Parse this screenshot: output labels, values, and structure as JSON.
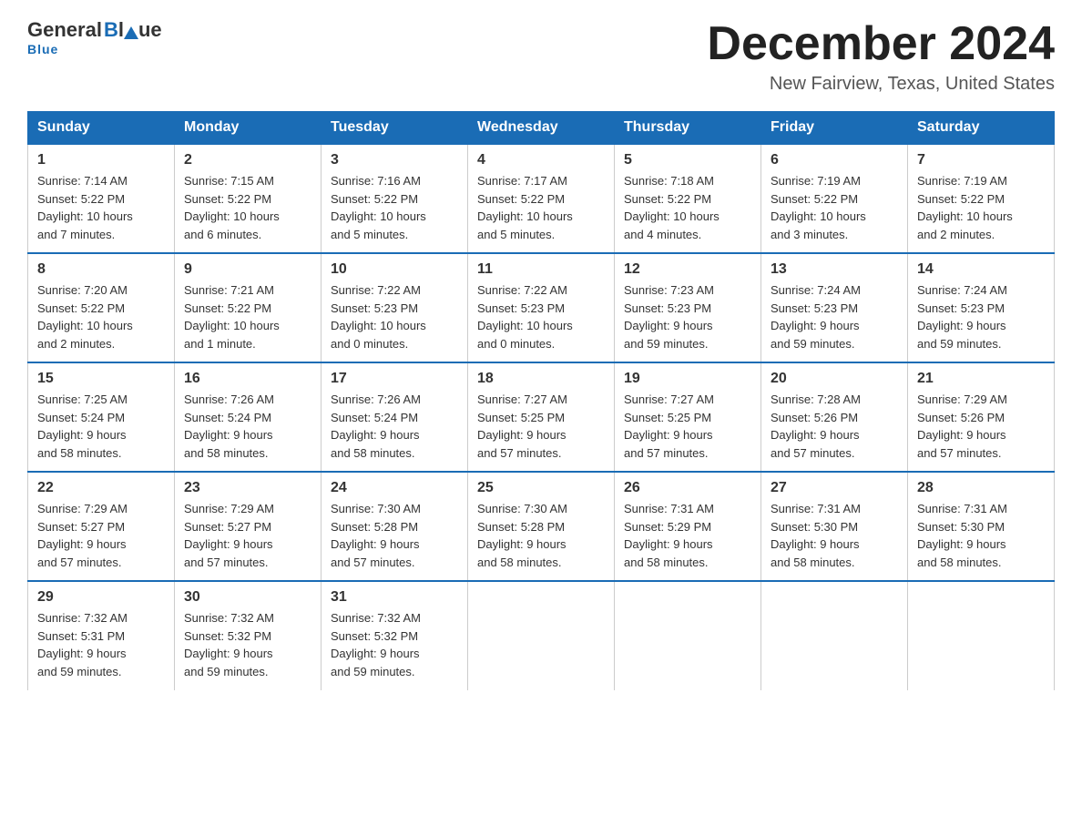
{
  "logo": {
    "general": "General",
    "blue": "Blue",
    "underline": "Blue"
  },
  "header": {
    "month_title": "December 2024",
    "location": "New Fairview, Texas, United States"
  },
  "days_of_week": [
    "Sunday",
    "Monday",
    "Tuesday",
    "Wednesday",
    "Thursday",
    "Friday",
    "Saturday"
  ],
  "weeks": [
    [
      {
        "day": "1",
        "text": "Sunrise: 7:14 AM\nSunset: 5:22 PM\nDaylight: 10 hours\nand 7 minutes."
      },
      {
        "day": "2",
        "text": "Sunrise: 7:15 AM\nSunset: 5:22 PM\nDaylight: 10 hours\nand 6 minutes."
      },
      {
        "day": "3",
        "text": "Sunrise: 7:16 AM\nSunset: 5:22 PM\nDaylight: 10 hours\nand 5 minutes."
      },
      {
        "day": "4",
        "text": "Sunrise: 7:17 AM\nSunset: 5:22 PM\nDaylight: 10 hours\nand 5 minutes."
      },
      {
        "day": "5",
        "text": "Sunrise: 7:18 AM\nSunset: 5:22 PM\nDaylight: 10 hours\nand 4 minutes."
      },
      {
        "day": "6",
        "text": "Sunrise: 7:19 AM\nSunset: 5:22 PM\nDaylight: 10 hours\nand 3 minutes."
      },
      {
        "day": "7",
        "text": "Sunrise: 7:19 AM\nSunset: 5:22 PM\nDaylight: 10 hours\nand 2 minutes."
      }
    ],
    [
      {
        "day": "8",
        "text": "Sunrise: 7:20 AM\nSunset: 5:22 PM\nDaylight: 10 hours\nand 2 minutes."
      },
      {
        "day": "9",
        "text": "Sunrise: 7:21 AM\nSunset: 5:22 PM\nDaylight: 10 hours\nand 1 minute."
      },
      {
        "day": "10",
        "text": "Sunrise: 7:22 AM\nSunset: 5:23 PM\nDaylight: 10 hours\nand 0 minutes."
      },
      {
        "day": "11",
        "text": "Sunrise: 7:22 AM\nSunset: 5:23 PM\nDaylight: 10 hours\nand 0 minutes."
      },
      {
        "day": "12",
        "text": "Sunrise: 7:23 AM\nSunset: 5:23 PM\nDaylight: 9 hours\nand 59 minutes."
      },
      {
        "day": "13",
        "text": "Sunrise: 7:24 AM\nSunset: 5:23 PM\nDaylight: 9 hours\nand 59 minutes."
      },
      {
        "day": "14",
        "text": "Sunrise: 7:24 AM\nSunset: 5:23 PM\nDaylight: 9 hours\nand 59 minutes."
      }
    ],
    [
      {
        "day": "15",
        "text": "Sunrise: 7:25 AM\nSunset: 5:24 PM\nDaylight: 9 hours\nand 58 minutes."
      },
      {
        "day": "16",
        "text": "Sunrise: 7:26 AM\nSunset: 5:24 PM\nDaylight: 9 hours\nand 58 minutes."
      },
      {
        "day": "17",
        "text": "Sunrise: 7:26 AM\nSunset: 5:24 PM\nDaylight: 9 hours\nand 58 minutes."
      },
      {
        "day": "18",
        "text": "Sunrise: 7:27 AM\nSunset: 5:25 PM\nDaylight: 9 hours\nand 57 minutes."
      },
      {
        "day": "19",
        "text": "Sunrise: 7:27 AM\nSunset: 5:25 PM\nDaylight: 9 hours\nand 57 minutes."
      },
      {
        "day": "20",
        "text": "Sunrise: 7:28 AM\nSunset: 5:26 PM\nDaylight: 9 hours\nand 57 minutes."
      },
      {
        "day": "21",
        "text": "Sunrise: 7:29 AM\nSunset: 5:26 PM\nDaylight: 9 hours\nand 57 minutes."
      }
    ],
    [
      {
        "day": "22",
        "text": "Sunrise: 7:29 AM\nSunset: 5:27 PM\nDaylight: 9 hours\nand 57 minutes."
      },
      {
        "day": "23",
        "text": "Sunrise: 7:29 AM\nSunset: 5:27 PM\nDaylight: 9 hours\nand 57 minutes."
      },
      {
        "day": "24",
        "text": "Sunrise: 7:30 AM\nSunset: 5:28 PM\nDaylight: 9 hours\nand 57 minutes."
      },
      {
        "day": "25",
        "text": "Sunrise: 7:30 AM\nSunset: 5:28 PM\nDaylight: 9 hours\nand 58 minutes."
      },
      {
        "day": "26",
        "text": "Sunrise: 7:31 AM\nSunset: 5:29 PM\nDaylight: 9 hours\nand 58 minutes."
      },
      {
        "day": "27",
        "text": "Sunrise: 7:31 AM\nSunset: 5:30 PM\nDaylight: 9 hours\nand 58 minutes."
      },
      {
        "day": "28",
        "text": "Sunrise: 7:31 AM\nSunset: 5:30 PM\nDaylight: 9 hours\nand 58 minutes."
      }
    ],
    [
      {
        "day": "29",
        "text": "Sunrise: 7:32 AM\nSunset: 5:31 PM\nDaylight: 9 hours\nand 59 minutes."
      },
      {
        "day": "30",
        "text": "Sunrise: 7:32 AM\nSunset: 5:32 PM\nDaylight: 9 hours\nand 59 minutes."
      },
      {
        "day": "31",
        "text": "Sunrise: 7:32 AM\nSunset: 5:32 PM\nDaylight: 9 hours\nand 59 minutes."
      },
      {
        "day": "",
        "text": ""
      },
      {
        "day": "",
        "text": ""
      },
      {
        "day": "",
        "text": ""
      },
      {
        "day": "",
        "text": ""
      }
    ]
  ]
}
